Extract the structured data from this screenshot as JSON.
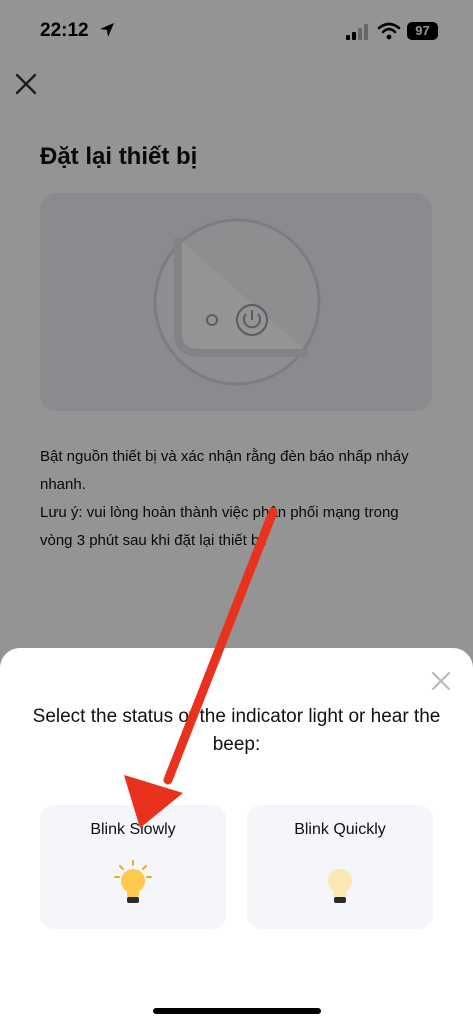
{
  "status_bar": {
    "time": "22:12",
    "battery": "97"
  },
  "page": {
    "title": "Đặt lại thiết bị",
    "description_line1": "Bật nguồn thiết bị và xác nhận rằng đèn báo nhấp nháy nhanh.",
    "description_line2": "Lưu ý: vui lòng hoàn thành việc phân phối mạng trong vòng 3 phút sau khi đặt lại thiết bị."
  },
  "sheet": {
    "prompt": "Select the status of the indicator light or hear the beep:",
    "options": [
      {
        "label": "Blink Slowly",
        "bulb_color": "#ffc94d"
      },
      {
        "label": "Blink Quickly",
        "bulb_color": "#fbe7b2"
      }
    ]
  },
  "annotation": {
    "arrow_color": "#e8321e"
  }
}
